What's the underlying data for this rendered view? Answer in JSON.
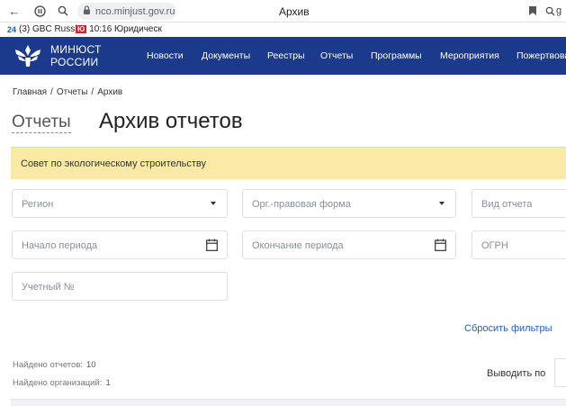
{
  "browser": {
    "url": "nco.minjust.gov.ru",
    "tab_title": "Архив",
    "back_icon": "arrow-left",
    "ext_icon": "pause-circle",
    "profile_icon": "search",
    "bookmark_icon": "bookmark",
    "more_label": "g",
    "bookmarks": [
      {
        "badge": "24",
        "label": "(3) GBC Russia"
      },
      {
        "badge": "Ю",
        "label": "10:16 Юридическ"
      }
    ]
  },
  "nav": {
    "brand_line1": "МИНЮСТ",
    "brand_line2": "РОССИИ",
    "items": [
      "Новости",
      "Документы",
      "Реестры",
      "Отчеты",
      "Программы",
      "Мероприятия",
      "Пожертвова"
    ]
  },
  "breadcrumb": [
    "Главная",
    "/",
    "Отчеты",
    "/",
    "Архив"
  ],
  "tabs": {
    "reports": "Отчеты"
  },
  "page_title": "Архив отчетов",
  "banner": {
    "text": "Совет по экологическому строительству"
  },
  "filters": {
    "region": "Регион",
    "org_form": "Орг.-правовая форма",
    "report_type": "Вид отчета",
    "period_start": "Начало периода",
    "period_end": "Окончание периода",
    "ogrn": "ОГРН",
    "account_no": "Учетный №",
    "reset": "Сбросить фильтры"
  },
  "results": {
    "reports_label": "Найдено отчетов:",
    "reports_count": "10",
    "orgs_label": "Найдено организаций:",
    "orgs_count": "1",
    "per_page_label": "Выводить по"
  },
  "colors": {
    "nav_bg": "#1c3a8c",
    "banner_bg": "#fbeaa6",
    "link": "#1f5fbf"
  }
}
